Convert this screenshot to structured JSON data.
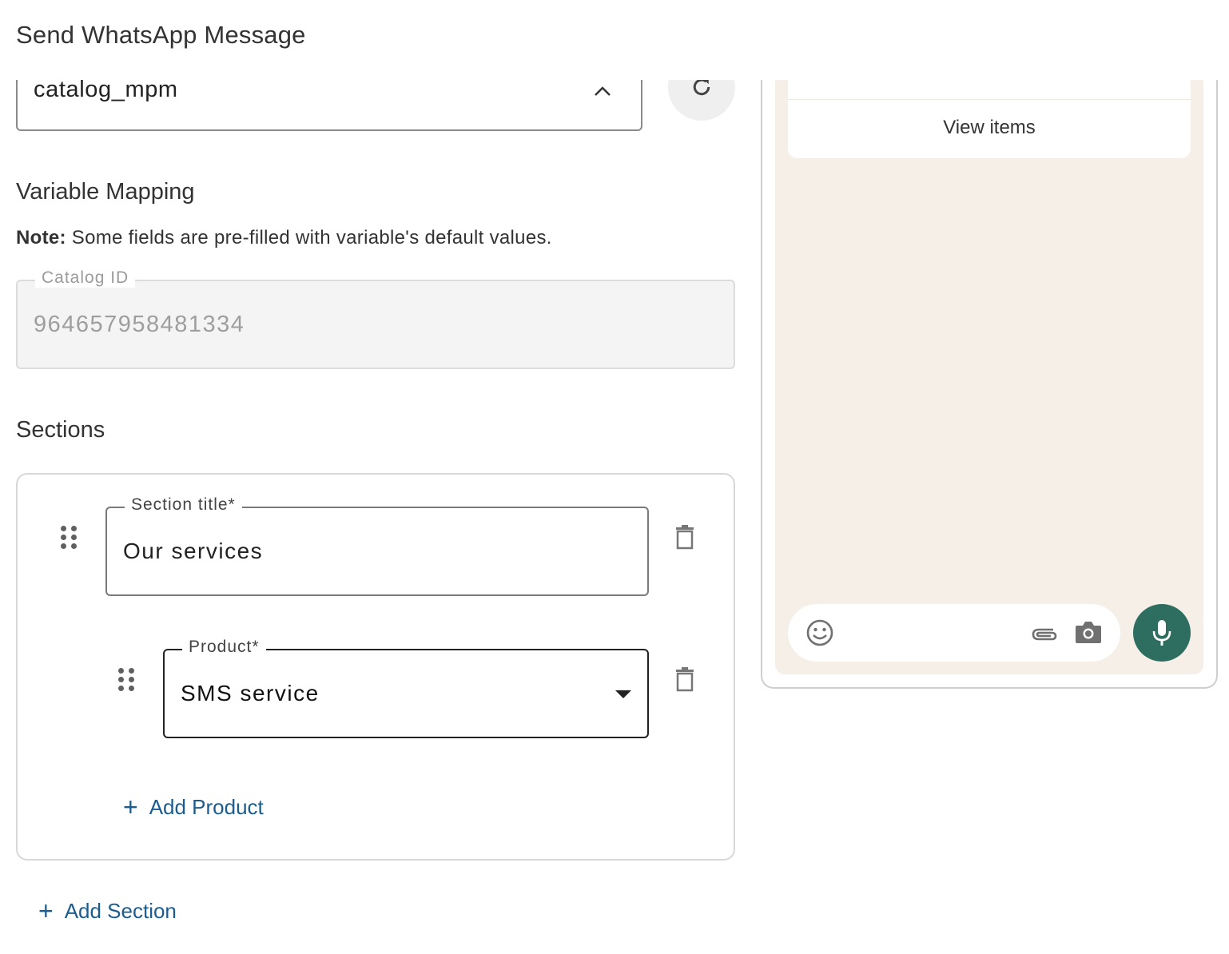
{
  "header": {
    "title": "Send WhatsApp Message"
  },
  "template_select": {
    "value": "catalog_mpm"
  },
  "variable_mapping": {
    "heading": "Variable Mapping",
    "note_label": "Note:",
    "note_text": " Some fields are pre-filled with variable's default values.",
    "catalog_id": {
      "label": "Catalog ID",
      "value": "964657958481334"
    }
  },
  "sections": {
    "heading": "Sections",
    "items": [
      {
        "title_label": "Section title*",
        "title_value": "Our services",
        "products": [
          {
            "label": "Product*",
            "value": "SMS service"
          }
        ],
        "add_product_label": "Add Product"
      }
    ],
    "add_section_label": "Add Section"
  },
  "preview": {
    "button_label": "View items"
  },
  "icons": {
    "chevron": "chevron-up-icon",
    "refresh": "refresh-icon",
    "drag": "drag-handle-icon",
    "delete": "trash-icon",
    "emoji": "emoji-icon",
    "attach": "paperclip-icon",
    "camera": "camera-icon",
    "mic": "microphone-icon"
  },
  "colors": {
    "link": "#1c5c8e",
    "chat_bg": "#f5efe7",
    "mic_button": "#2e6e60"
  }
}
